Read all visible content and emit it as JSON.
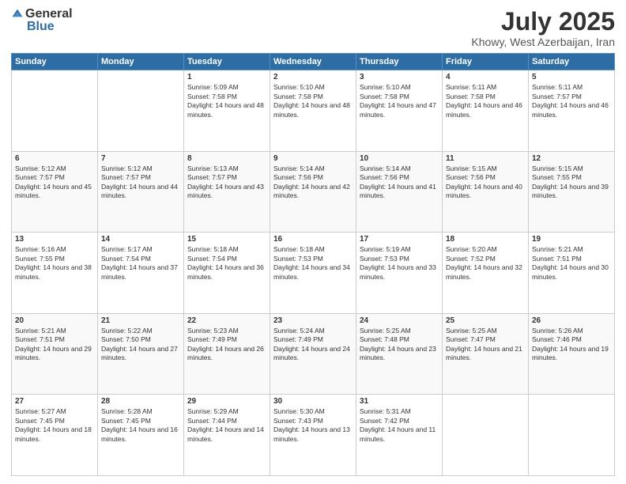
{
  "logo": {
    "general": "General",
    "blue": "Blue"
  },
  "header": {
    "month": "July 2025",
    "location": "Khowy, West Azerbaijan, Iran"
  },
  "weekdays": [
    "Sunday",
    "Monday",
    "Tuesday",
    "Wednesday",
    "Thursday",
    "Friday",
    "Saturday"
  ],
  "weeks": [
    [
      {
        "day": "",
        "sunrise": "",
        "sunset": "",
        "daylight": ""
      },
      {
        "day": "",
        "sunrise": "",
        "sunset": "",
        "daylight": ""
      },
      {
        "day": "1",
        "sunrise": "Sunrise: 5:09 AM",
        "sunset": "Sunset: 7:58 PM",
        "daylight": "Daylight: 14 hours and 48 minutes."
      },
      {
        "day": "2",
        "sunrise": "Sunrise: 5:10 AM",
        "sunset": "Sunset: 7:58 PM",
        "daylight": "Daylight: 14 hours and 48 minutes."
      },
      {
        "day": "3",
        "sunrise": "Sunrise: 5:10 AM",
        "sunset": "Sunset: 7:58 PM",
        "daylight": "Daylight: 14 hours and 47 minutes."
      },
      {
        "day": "4",
        "sunrise": "Sunrise: 5:11 AM",
        "sunset": "Sunset: 7:58 PM",
        "daylight": "Daylight: 14 hours and 46 minutes."
      },
      {
        "day": "5",
        "sunrise": "Sunrise: 5:11 AM",
        "sunset": "Sunset: 7:57 PM",
        "daylight": "Daylight: 14 hours and 46 minutes."
      }
    ],
    [
      {
        "day": "6",
        "sunrise": "Sunrise: 5:12 AM",
        "sunset": "Sunset: 7:57 PM",
        "daylight": "Daylight: 14 hours and 45 minutes."
      },
      {
        "day": "7",
        "sunrise": "Sunrise: 5:12 AM",
        "sunset": "Sunset: 7:57 PM",
        "daylight": "Daylight: 14 hours and 44 minutes."
      },
      {
        "day": "8",
        "sunrise": "Sunrise: 5:13 AM",
        "sunset": "Sunset: 7:57 PM",
        "daylight": "Daylight: 14 hours and 43 minutes."
      },
      {
        "day": "9",
        "sunrise": "Sunrise: 5:14 AM",
        "sunset": "Sunset: 7:56 PM",
        "daylight": "Daylight: 14 hours and 42 minutes."
      },
      {
        "day": "10",
        "sunrise": "Sunrise: 5:14 AM",
        "sunset": "Sunset: 7:56 PM",
        "daylight": "Daylight: 14 hours and 41 minutes."
      },
      {
        "day": "11",
        "sunrise": "Sunrise: 5:15 AM",
        "sunset": "Sunset: 7:56 PM",
        "daylight": "Daylight: 14 hours and 40 minutes."
      },
      {
        "day": "12",
        "sunrise": "Sunrise: 5:15 AM",
        "sunset": "Sunset: 7:55 PM",
        "daylight": "Daylight: 14 hours and 39 minutes."
      }
    ],
    [
      {
        "day": "13",
        "sunrise": "Sunrise: 5:16 AM",
        "sunset": "Sunset: 7:55 PM",
        "daylight": "Daylight: 14 hours and 38 minutes."
      },
      {
        "day": "14",
        "sunrise": "Sunrise: 5:17 AM",
        "sunset": "Sunset: 7:54 PM",
        "daylight": "Daylight: 14 hours and 37 minutes."
      },
      {
        "day": "15",
        "sunrise": "Sunrise: 5:18 AM",
        "sunset": "Sunset: 7:54 PM",
        "daylight": "Daylight: 14 hours and 36 minutes."
      },
      {
        "day": "16",
        "sunrise": "Sunrise: 5:18 AM",
        "sunset": "Sunset: 7:53 PM",
        "daylight": "Daylight: 14 hours and 34 minutes."
      },
      {
        "day": "17",
        "sunrise": "Sunrise: 5:19 AM",
        "sunset": "Sunset: 7:53 PM",
        "daylight": "Daylight: 14 hours and 33 minutes."
      },
      {
        "day": "18",
        "sunrise": "Sunrise: 5:20 AM",
        "sunset": "Sunset: 7:52 PM",
        "daylight": "Daylight: 14 hours and 32 minutes."
      },
      {
        "day": "19",
        "sunrise": "Sunrise: 5:21 AM",
        "sunset": "Sunset: 7:51 PM",
        "daylight": "Daylight: 14 hours and 30 minutes."
      }
    ],
    [
      {
        "day": "20",
        "sunrise": "Sunrise: 5:21 AM",
        "sunset": "Sunset: 7:51 PM",
        "daylight": "Daylight: 14 hours and 29 minutes."
      },
      {
        "day": "21",
        "sunrise": "Sunrise: 5:22 AM",
        "sunset": "Sunset: 7:50 PM",
        "daylight": "Daylight: 14 hours and 27 minutes."
      },
      {
        "day": "22",
        "sunrise": "Sunrise: 5:23 AM",
        "sunset": "Sunset: 7:49 PM",
        "daylight": "Daylight: 14 hours and 26 minutes."
      },
      {
        "day": "23",
        "sunrise": "Sunrise: 5:24 AM",
        "sunset": "Sunset: 7:49 PM",
        "daylight": "Daylight: 14 hours and 24 minutes."
      },
      {
        "day": "24",
        "sunrise": "Sunrise: 5:25 AM",
        "sunset": "Sunset: 7:48 PM",
        "daylight": "Daylight: 14 hours and 23 minutes."
      },
      {
        "day": "25",
        "sunrise": "Sunrise: 5:25 AM",
        "sunset": "Sunset: 7:47 PM",
        "daylight": "Daylight: 14 hours and 21 minutes."
      },
      {
        "day": "26",
        "sunrise": "Sunrise: 5:26 AM",
        "sunset": "Sunset: 7:46 PM",
        "daylight": "Daylight: 14 hours and 19 minutes."
      }
    ],
    [
      {
        "day": "27",
        "sunrise": "Sunrise: 5:27 AM",
        "sunset": "Sunset: 7:45 PM",
        "daylight": "Daylight: 14 hours and 18 minutes."
      },
      {
        "day": "28",
        "sunrise": "Sunrise: 5:28 AM",
        "sunset": "Sunset: 7:45 PM",
        "daylight": "Daylight: 14 hours and 16 minutes."
      },
      {
        "day": "29",
        "sunrise": "Sunrise: 5:29 AM",
        "sunset": "Sunset: 7:44 PM",
        "daylight": "Daylight: 14 hours and 14 minutes."
      },
      {
        "day": "30",
        "sunrise": "Sunrise: 5:30 AM",
        "sunset": "Sunset: 7:43 PM",
        "daylight": "Daylight: 14 hours and 13 minutes."
      },
      {
        "day": "31",
        "sunrise": "Sunrise: 5:31 AM",
        "sunset": "Sunset: 7:42 PM",
        "daylight": "Daylight: 14 hours and 11 minutes."
      },
      {
        "day": "",
        "sunrise": "",
        "sunset": "",
        "daylight": ""
      },
      {
        "day": "",
        "sunrise": "",
        "sunset": "",
        "daylight": ""
      }
    ]
  ]
}
